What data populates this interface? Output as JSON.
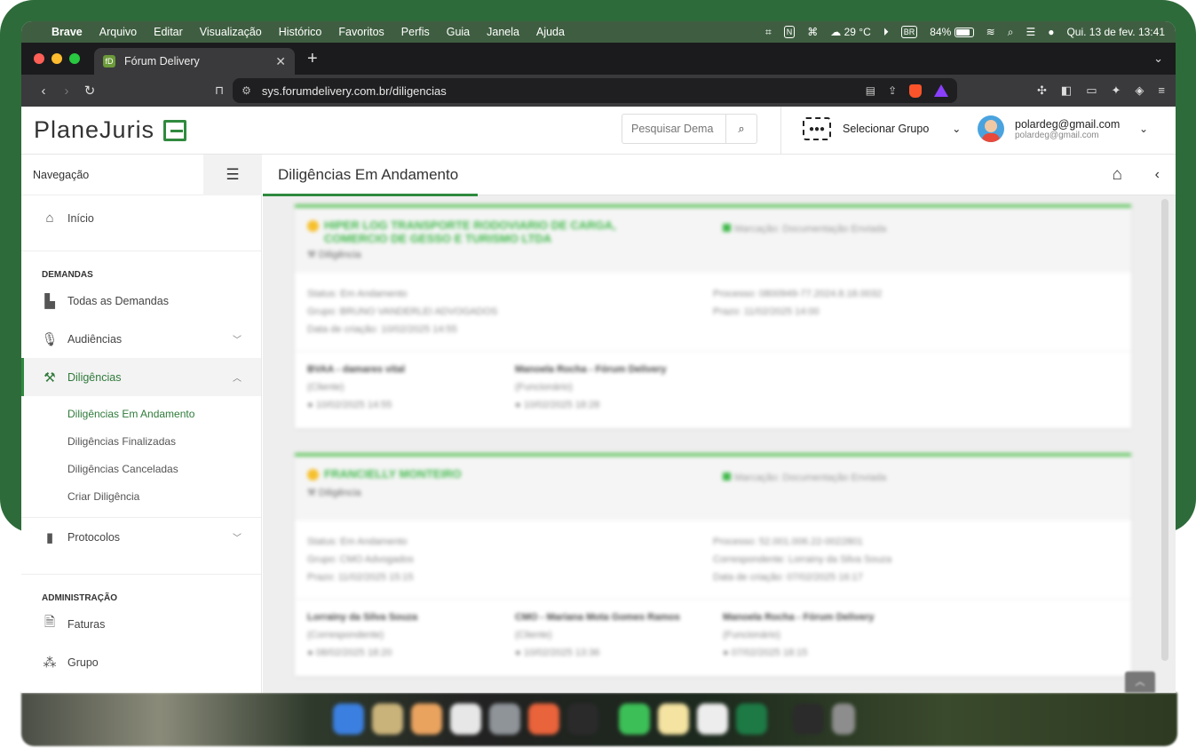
{
  "menubar": {
    "apple": "",
    "items": [
      "Brave",
      "Arquivo",
      "Editar",
      "Visualização",
      "Histórico",
      "Favoritos",
      "Perfis",
      "Guia",
      "Janela",
      "Ajuda"
    ],
    "weather": "29 °C",
    "input_source": "BR",
    "battery": "84%",
    "datetime": "Qui. 13 de fev.  13:41"
  },
  "browser": {
    "tab_title": "Fórum Delivery",
    "url": "sys.forumdelivery.com.br/diligencias"
  },
  "header": {
    "logo_text": "PlaneJuris",
    "search_placeholder": "Pesquisar Dema",
    "group_label": "Selecionar Grupo",
    "user_email": "polardeg@gmail.com",
    "user_email_sub": "polardeg@gmail.com"
  },
  "sidebar": {
    "title": "Navegação",
    "inicio": "Início",
    "section_demandas": "DEMANDAS",
    "todas": "Todas as Demandas",
    "audiencias": "Audiências",
    "diligencias": "Diligências",
    "sub": [
      "Diligências Em Andamento",
      "Diligências Finalizadas",
      "Diligências Canceladas",
      "Criar Diligência"
    ],
    "protocolos": "Protocolos",
    "section_admin": "ADMINISTRAÇÃO",
    "faturas": "Faturas",
    "grupo": "Grupo"
  },
  "page": {
    "title": "Diligências Em Andamento"
  },
  "cards": [
    {
      "name": "HIPER LOG TRANSPORTE RODOVIARIO DE CARGA, COMERCIO DE GESSO E TURISMO LTDA",
      "kind": "Diligência",
      "marcacao": "Marcação: Documentação Enviada",
      "status": "Status: Em Andamento",
      "grupo": "Grupo: BRUNO VANDERLEI ADVOGADOS",
      "criacao": "Data de criação: 10/02/2025 14:55",
      "processo": "Processo: 0800949-77.2024.8.18.0032",
      "prazo": "Prazo: 11/02/2025 14:00",
      "people": [
        {
          "name": "BVAA - damares vital",
          "role": "(Cliente)",
          "date": "10/02/2025 14:55"
        },
        {
          "name": "Manoela Rocha - Fórum Delivery",
          "role": "(Funcionário)",
          "date": "10/02/2025 18:28"
        }
      ]
    },
    {
      "name": "FRANCIELLY MONTEIRO",
      "kind": "Diligência",
      "marcacao": "Marcação: Documentação Enviada",
      "status": "Status: Em Andamento",
      "grupo": "Grupo: CMO Advogados",
      "prazo": "Prazo: 11/02/2025 15:15",
      "processo": "Processo: 52.001.006.22-0022801",
      "correspondente": "Correspondente: Lorrainy da Silva Souza",
      "criacao": "Data de criação: 07/02/2025 16:17",
      "people": [
        {
          "name": "Lorrainy da Silva Souza",
          "role": "(Correspondente)",
          "date": "08/02/2025 18:20"
        },
        {
          "name": "CMO - Mariana Mota Gomes Ramos",
          "role": "(Cliente)",
          "date": "10/02/2025 13:36"
        },
        {
          "name": "Manoela Rocha - Fórum Delivery",
          "role": "(Funcionário)",
          "date": "07/02/2025 18:15"
        }
      ]
    }
  ]
}
